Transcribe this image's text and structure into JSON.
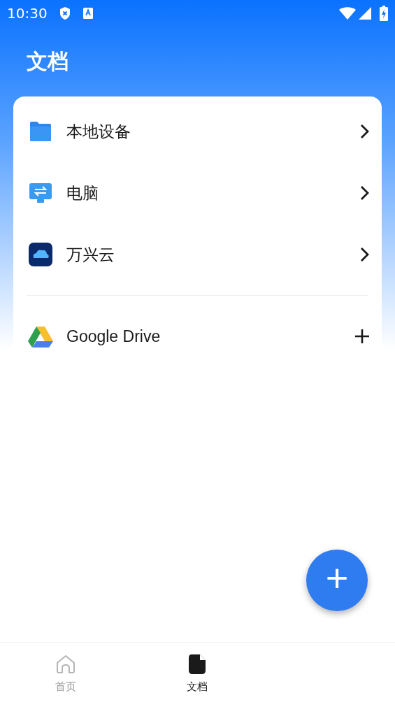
{
  "status_bar": {
    "time": "10:30"
  },
  "header": {
    "title": "文档"
  },
  "sections": [
    {
      "items": [
        {
          "label": "本地设备",
          "kind": "chevron"
        },
        {
          "label": "电脑",
          "kind": "chevron"
        },
        {
          "label": "万兴云",
          "kind": "chevron"
        }
      ]
    },
    {
      "items": [
        {
          "label": "Google Drive",
          "kind": "add"
        }
      ]
    }
  ],
  "fab": {
    "label": "+"
  },
  "bottom_nav": [
    {
      "label": "首页",
      "selected": false
    },
    {
      "label": "文档",
      "selected": true
    }
  ]
}
